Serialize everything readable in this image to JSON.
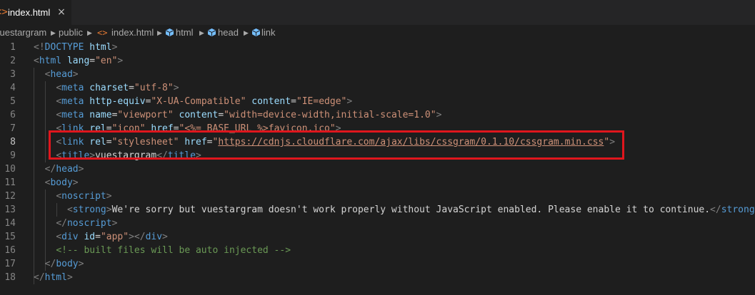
{
  "tab": {
    "label": "index.html",
    "close": "×",
    "icon": "<>"
  },
  "breadcrumb": {
    "items": [
      "vuestargram",
      "public",
      "index.html",
      "html",
      "head",
      "link"
    ],
    "icons": {
      "file": "html-file-icon",
      "element": "symbol-element-icon"
    }
  },
  "editor": {
    "line_numbers": [
      "1",
      "2",
      "3",
      "4",
      "5",
      "6",
      "7",
      "8",
      "9",
      "10",
      "11",
      "12",
      "13",
      "14",
      "15",
      "16",
      "17",
      "18"
    ],
    "active_line": "8",
    "lines": [
      [
        [
          "<!",
          "punc"
        ],
        [
          "DOCTYPE",
          "tag"
        ],
        [
          " ",
          "text"
        ],
        [
          "html",
          "attr"
        ],
        [
          ">",
          "punc"
        ]
      ],
      [
        [
          "<",
          "punc"
        ],
        [
          "html",
          "tag"
        ],
        [
          " ",
          "text"
        ],
        [
          "lang",
          "attr"
        ],
        [
          "=",
          "text"
        ],
        [
          "\"en\"",
          "str"
        ],
        [
          ">",
          "punc"
        ]
      ],
      [
        [
          "  ",
          "text"
        ],
        [
          "<",
          "punc"
        ],
        [
          "head",
          "tag"
        ],
        [
          ">",
          "punc"
        ]
      ],
      [
        [
          "    ",
          "text"
        ],
        [
          "<",
          "punc"
        ],
        [
          "meta",
          "tag"
        ],
        [
          " ",
          "text"
        ],
        [
          "charset",
          "attr"
        ],
        [
          "=",
          "text"
        ],
        [
          "\"utf-8\"",
          "str"
        ],
        [
          ">",
          "punc"
        ]
      ],
      [
        [
          "    ",
          "text"
        ],
        [
          "<",
          "punc"
        ],
        [
          "meta",
          "tag"
        ],
        [
          " ",
          "text"
        ],
        [
          "http-equiv",
          "attr"
        ],
        [
          "=",
          "text"
        ],
        [
          "\"X-UA-Compatible\"",
          "str"
        ],
        [
          " ",
          "text"
        ],
        [
          "content",
          "attr"
        ],
        [
          "=",
          "text"
        ],
        [
          "\"IE=edge\"",
          "str"
        ],
        [
          ">",
          "punc"
        ]
      ],
      [
        [
          "    ",
          "text"
        ],
        [
          "<",
          "punc"
        ],
        [
          "meta",
          "tag"
        ],
        [
          " ",
          "text"
        ],
        [
          "name",
          "attr"
        ],
        [
          "=",
          "text"
        ],
        [
          "\"viewport\"",
          "str"
        ],
        [
          " ",
          "text"
        ],
        [
          "content",
          "attr"
        ],
        [
          "=",
          "text"
        ],
        [
          "\"width=device-width,initial-scale=1.0\"",
          "str"
        ],
        [
          ">",
          "punc"
        ]
      ],
      [
        [
          "    ",
          "text"
        ],
        [
          "<",
          "punc"
        ],
        [
          "link",
          "tag"
        ],
        [
          " ",
          "text"
        ],
        [
          "rel",
          "attr"
        ],
        [
          "=",
          "text"
        ],
        [
          "\"icon\"",
          "str"
        ],
        [
          " ",
          "text"
        ],
        [
          "href",
          "attr"
        ],
        [
          "=",
          "text"
        ],
        [
          "\"<%= BASE_URL %>favicon.ico\"",
          "str"
        ],
        [
          ">",
          "punc"
        ]
      ],
      [
        [
          "    ",
          "text"
        ],
        [
          "<",
          "punc"
        ],
        [
          "link",
          "tag"
        ],
        [
          " ",
          "text"
        ],
        [
          "rel",
          "attr"
        ],
        [
          "=",
          "text"
        ],
        [
          "\"stylesheet\"",
          "str"
        ],
        [
          " ",
          "text"
        ],
        [
          "href",
          "attr"
        ],
        [
          "=",
          "text"
        ],
        [
          "\"",
          "str"
        ],
        [
          "https://cdnjs.cloudflare.com/ajax/libs/cssgram/0.1.10/cssgram.min.css",
          "link"
        ],
        [
          "\"",
          "str"
        ],
        [
          ">",
          "punc"
        ]
      ],
      [
        [
          "    ",
          "text"
        ],
        [
          "<",
          "punc"
        ],
        [
          "title",
          "tag"
        ],
        [
          ">",
          "punc"
        ],
        [
          "vuestargram",
          "text"
        ],
        [
          "</",
          "punc"
        ],
        [
          "title",
          "tag"
        ],
        [
          ">",
          "punc"
        ]
      ],
      [
        [
          "  ",
          "text"
        ],
        [
          "</",
          "punc"
        ],
        [
          "head",
          "tag"
        ],
        [
          ">",
          "punc"
        ]
      ],
      [
        [
          "  ",
          "text"
        ],
        [
          "<",
          "punc"
        ],
        [
          "body",
          "tag"
        ],
        [
          ">",
          "punc"
        ]
      ],
      [
        [
          "    ",
          "text"
        ],
        [
          "<",
          "punc"
        ],
        [
          "noscript",
          "tag"
        ],
        [
          ">",
          "punc"
        ]
      ],
      [
        [
          "      ",
          "text"
        ],
        [
          "<",
          "punc"
        ],
        [
          "strong",
          "tag"
        ],
        [
          ">",
          "punc"
        ],
        [
          "We're sorry but vuestargram doesn't work properly without JavaScript enabled. Please enable it to continue.",
          "text"
        ],
        [
          "</",
          "punc"
        ],
        [
          "strong",
          "tag"
        ],
        [
          ">",
          "punc"
        ]
      ],
      [
        [
          "    ",
          "text"
        ],
        [
          "</",
          "punc"
        ],
        [
          "noscript",
          "tag"
        ],
        [
          ">",
          "punc"
        ]
      ],
      [
        [
          "    ",
          "text"
        ],
        [
          "<",
          "punc"
        ],
        [
          "div",
          "tag"
        ],
        [
          " ",
          "text"
        ],
        [
          "id",
          "attr"
        ],
        [
          "=",
          "text"
        ],
        [
          "\"app\"",
          "str"
        ],
        [
          "></",
          "punc"
        ],
        [
          "div",
          "tag"
        ],
        [
          ">",
          "punc"
        ]
      ],
      [
        [
          "    ",
          "text"
        ],
        [
          "<!-- built files will be auto injected -->",
          "com"
        ]
      ],
      [
        [
          "  ",
          "text"
        ],
        [
          "</",
          "punc"
        ],
        [
          "body",
          "tag"
        ],
        [
          ">",
          "punc"
        ]
      ],
      [
        [
          "</",
          "punc"
        ],
        [
          "html",
          "tag"
        ],
        [
          ">",
          "punc"
        ]
      ]
    ]
  },
  "annotation": {
    "color": "#e0161d"
  }
}
